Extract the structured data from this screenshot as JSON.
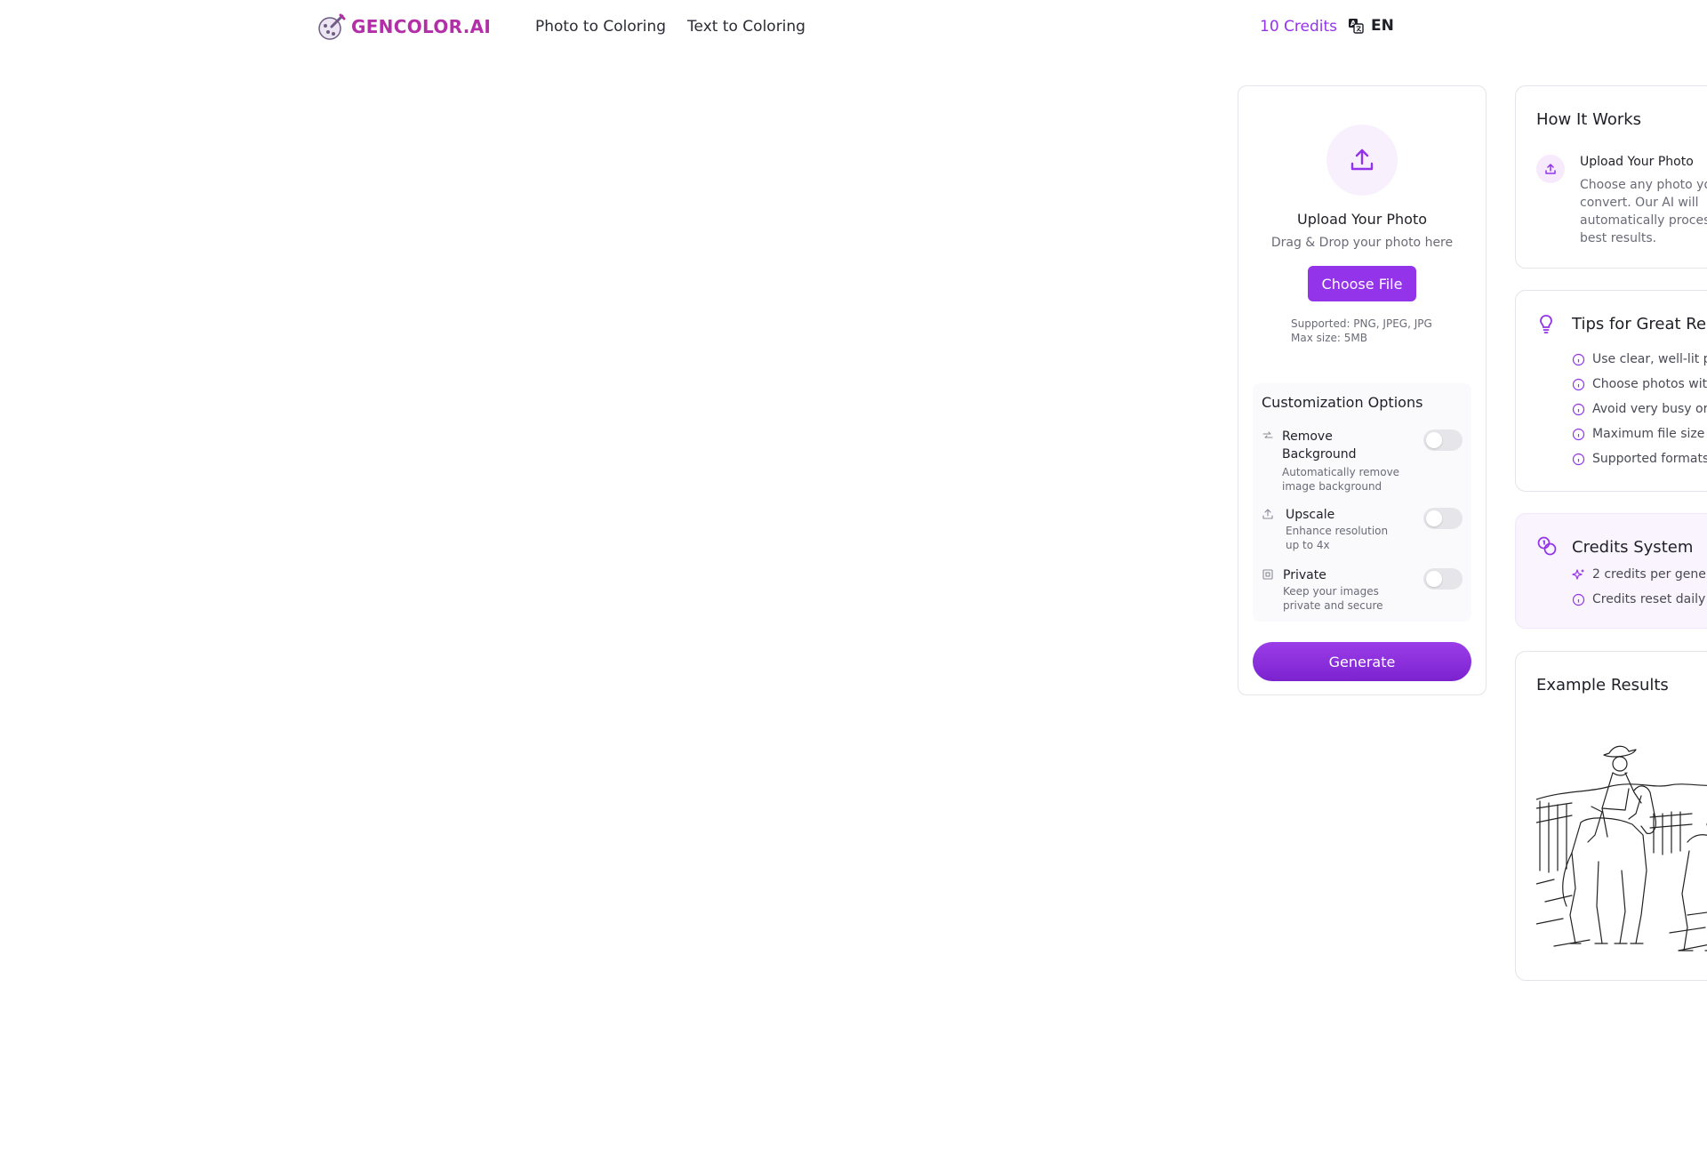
{
  "header": {
    "logo_text": "GENCOLOR.AI",
    "nav": [
      "Photo to Coloring",
      "Text to Coloring"
    ],
    "credits": "10 Credits",
    "language": "EN"
  },
  "upload": {
    "title": "Upload Your Photo",
    "subtitle": "Drag & Drop your photo here",
    "button": "Choose File",
    "supported": "Supported: PNG, JPEG, JPG",
    "max_size": "Max size: 5MB"
  },
  "customization": {
    "title": "Customization Options",
    "options": [
      {
        "label_line1": "Remove",
        "label_line2": "Background",
        "desc_line1": "Automatically remove",
        "desc_line2": "image background",
        "enabled": false
      },
      {
        "label_line1": "Upscale",
        "label_line2": "",
        "desc_line1": "Enhance resolution",
        "desc_line2": "up to 4x",
        "enabled": false
      },
      {
        "label_line1": "Private",
        "label_line2": "",
        "desc_line1": "Keep your images",
        "desc_line2": "private and secure",
        "enabled": false
      }
    ]
  },
  "generate_label": "Generate",
  "how_it_works": {
    "title": "How It Works",
    "step_title": "Upload Your Photo",
    "step_desc_lines": [
      "Choose any photo yo",
      "convert. Our AI will",
      "automatically proces",
      "best results."
    ]
  },
  "tips": {
    "title": "Tips for Great Re",
    "items": [
      "Use clear, well-lit p",
      "Choose photos wit",
      "Avoid very busy or",
      "Maximum file size",
      "Supported formats"
    ]
  },
  "credits_system": {
    "title": "Credits System",
    "items": [
      "2 credits per gene",
      "Credits reset daily"
    ]
  },
  "examples": {
    "title": "Example Results"
  },
  "colors": {
    "brand": "#b22fa7",
    "accent": "#9333ea",
    "accent_light": "#f8f0fd"
  }
}
